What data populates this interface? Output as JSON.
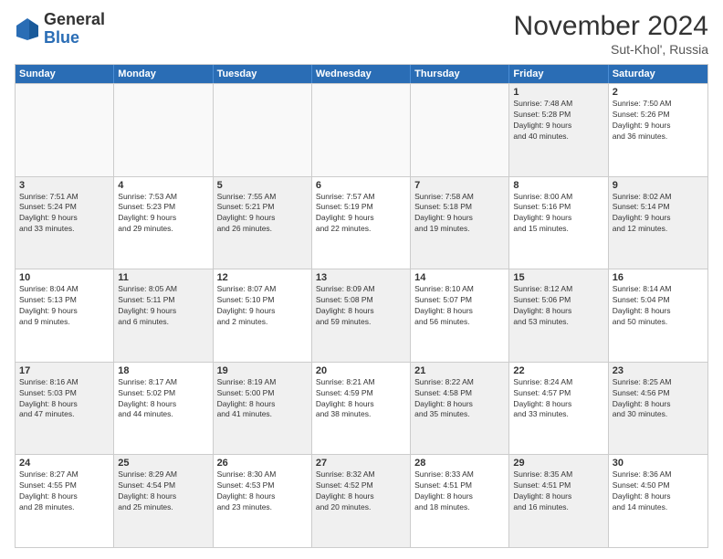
{
  "header": {
    "logo_general": "General",
    "logo_blue": "Blue",
    "month_title": "November 2024",
    "subtitle": "Sut-Khol', Russia"
  },
  "days_of_week": [
    "Sunday",
    "Monday",
    "Tuesday",
    "Wednesday",
    "Thursday",
    "Friday",
    "Saturday"
  ],
  "rows": [
    [
      {
        "num": "",
        "info": "",
        "empty": true
      },
      {
        "num": "",
        "info": "",
        "empty": true
      },
      {
        "num": "",
        "info": "",
        "empty": true
      },
      {
        "num": "",
        "info": "",
        "empty": true
      },
      {
        "num": "",
        "info": "",
        "empty": true
      },
      {
        "num": "1",
        "info": "Sunrise: 7:48 AM\nSunset: 5:28 PM\nDaylight: 9 hours\nand 40 minutes.",
        "shaded": true
      },
      {
        "num": "2",
        "info": "Sunrise: 7:50 AM\nSunset: 5:26 PM\nDaylight: 9 hours\nand 36 minutes.",
        "shaded": false
      }
    ],
    [
      {
        "num": "3",
        "info": "Sunrise: 7:51 AM\nSunset: 5:24 PM\nDaylight: 9 hours\nand 33 minutes.",
        "shaded": true
      },
      {
        "num": "4",
        "info": "Sunrise: 7:53 AM\nSunset: 5:23 PM\nDaylight: 9 hours\nand 29 minutes.",
        "shaded": false
      },
      {
        "num": "5",
        "info": "Sunrise: 7:55 AM\nSunset: 5:21 PM\nDaylight: 9 hours\nand 26 minutes.",
        "shaded": true
      },
      {
        "num": "6",
        "info": "Sunrise: 7:57 AM\nSunset: 5:19 PM\nDaylight: 9 hours\nand 22 minutes.",
        "shaded": false
      },
      {
        "num": "7",
        "info": "Sunrise: 7:58 AM\nSunset: 5:18 PM\nDaylight: 9 hours\nand 19 minutes.",
        "shaded": true
      },
      {
        "num": "8",
        "info": "Sunrise: 8:00 AM\nSunset: 5:16 PM\nDaylight: 9 hours\nand 15 minutes.",
        "shaded": false
      },
      {
        "num": "9",
        "info": "Sunrise: 8:02 AM\nSunset: 5:14 PM\nDaylight: 9 hours\nand 12 minutes.",
        "shaded": true
      }
    ],
    [
      {
        "num": "10",
        "info": "Sunrise: 8:04 AM\nSunset: 5:13 PM\nDaylight: 9 hours\nand 9 minutes.",
        "shaded": false
      },
      {
        "num": "11",
        "info": "Sunrise: 8:05 AM\nSunset: 5:11 PM\nDaylight: 9 hours\nand 6 minutes.",
        "shaded": true
      },
      {
        "num": "12",
        "info": "Sunrise: 8:07 AM\nSunset: 5:10 PM\nDaylight: 9 hours\nand 2 minutes.",
        "shaded": false
      },
      {
        "num": "13",
        "info": "Sunrise: 8:09 AM\nSunset: 5:08 PM\nDaylight: 8 hours\nand 59 minutes.",
        "shaded": true
      },
      {
        "num": "14",
        "info": "Sunrise: 8:10 AM\nSunset: 5:07 PM\nDaylight: 8 hours\nand 56 minutes.",
        "shaded": false
      },
      {
        "num": "15",
        "info": "Sunrise: 8:12 AM\nSunset: 5:06 PM\nDaylight: 8 hours\nand 53 minutes.",
        "shaded": true
      },
      {
        "num": "16",
        "info": "Sunrise: 8:14 AM\nSunset: 5:04 PM\nDaylight: 8 hours\nand 50 minutes.",
        "shaded": false
      }
    ],
    [
      {
        "num": "17",
        "info": "Sunrise: 8:16 AM\nSunset: 5:03 PM\nDaylight: 8 hours\nand 47 minutes.",
        "shaded": true
      },
      {
        "num": "18",
        "info": "Sunrise: 8:17 AM\nSunset: 5:02 PM\nDaylight: 8 hours\nand 44 minutes.",
        "shaded": false
      },
      {
        "num": "19",
        "info": "Sunrise: 8:19 AM\nSunset: 5:00 PM\nDaylight: 8 hours\nand 41 minutes.",
        "shaded": true
      },
      {
        "num": "20",
        "info": "Sunrise: 8:21 AM\nSunset: 4:59 PM\nDaylight: 8 hours\nand 38 minutes.",
        "shaded": false
      },
      {
        "num": "21",
        "info": "Sunrise: 8:22 AM\nSunset: 4:58 PM\nDaylight: 8 hours\nand 35 minutes.",
        "shaded": true
      },
      {
        "num": "22",
        "info": "Sunrise: 8:24 AM\nSunset: 4:57 PM\nDaylight: 8 hours\nand 33 minutes.",
        "shaded": false
      },
      {
        "num": "23",
        "info": "Sunrise: 8:25 AM\nSunset: 4:56 PM\nDaylight: 8 hours\nand 30 minutes.",
        "shaded": true
      }
    ],
    [
      {
        "num": "24",
        "info": "Sunrise: 8:27 AM\nSunset: 4:55 PM\nDaylight: 8 hours\nand 28 minutes.",
        "shaded": false
      },
      {
        "num": "25",
        "info": "Sunrise: 8:29 AM\nSunset: 4:54 PM\nDaylight: 8 hours\nand 25 minutes.",
        "shaded": true
      },
      {
        "num": "26",
        "info": "Sunrise: 8:30 AM\nSunset: 4:53 PM\nDaylight: 8 hours\nand 23 minutes.",
        "shaded": false
      },
      {
        "num": "27",
        "info": "Sunrise: 8:32 AM\nSunset: 4:52 PM\nDaylight: 8 hours\nand 20 minutes.",
        "shaded": true
      },
      {
        "num": "28",
        "info": "Sunrise: 8:33 AM\nSunset: 4:51 PM\nDaylight: 8 hours\nand 18 minutes.",
        "shaded": false
      },
      {
        "num": "29",
        "info": "Sunrise: 8:35 AM\nSunset: 4:51 PM\nDaylight: 8 hours\nand 16 minutes.",
        "shaded": true
      },
      {
        "num": "30",
        "info": "Sunrise: 8:36 AM\nSunset: 4:50 PM\nDaylight: 8 hours\nand 14 minutes.",
        "shaded": false
      }
    ]
  ]
}
